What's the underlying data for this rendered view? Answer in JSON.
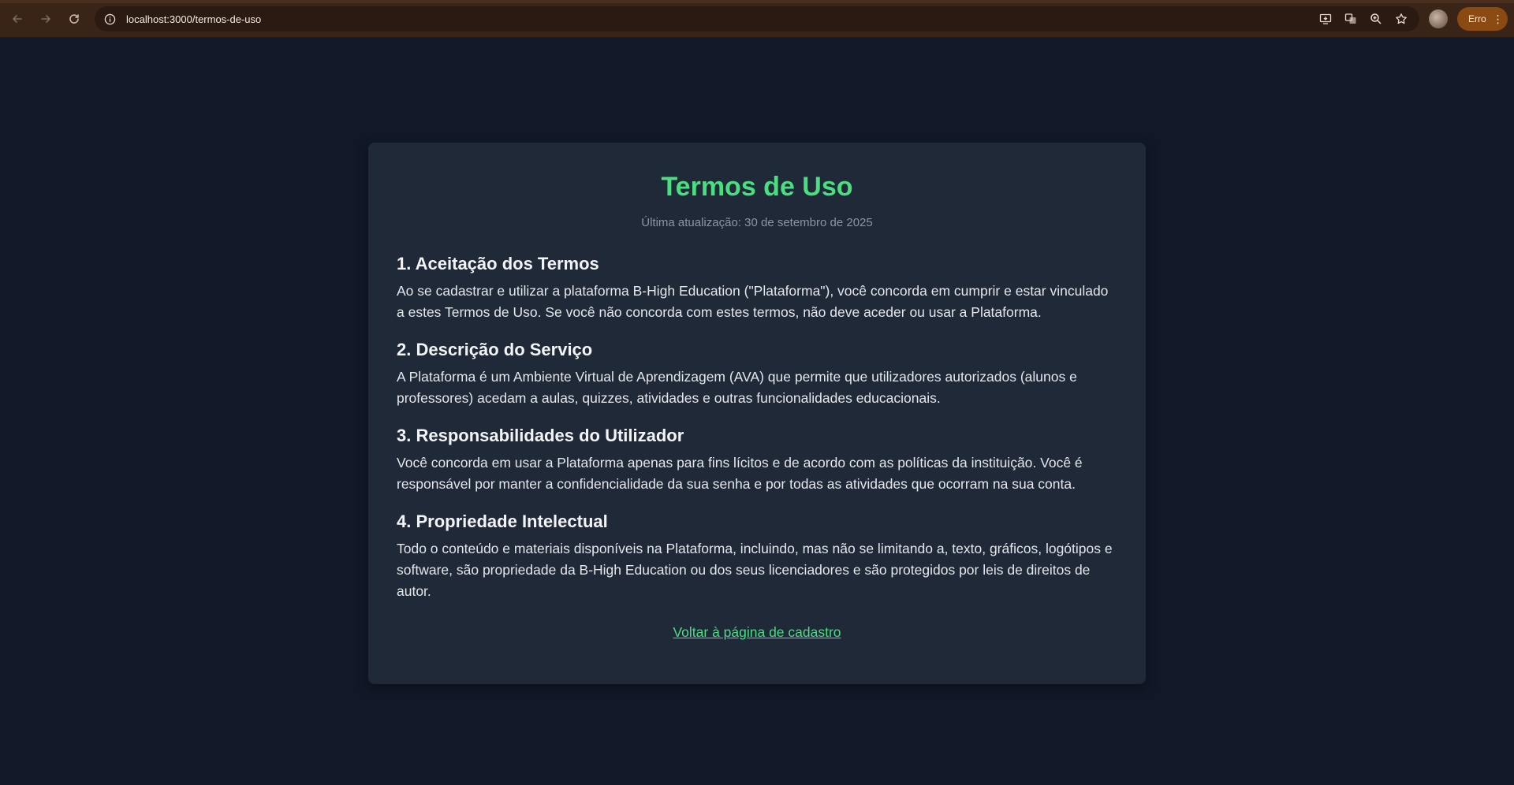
{
  "browser": {
    "url": "localhost:3000/termos-de-uso",
    "profile_chip_label": "Erro"
  },
  "page": {
    "title": "Termos de Uso",
    "last_updated": "Última atualização: 30 de setembro de 2025",
    "sections": [
      {
        "heading": "1. Aceitação dos Termos",
        "body": "Ao se cadastrar e utilizar a plataforma B-High Education (\"Plataforma\"), você concorda em cumprir e estar vinculado a estes Termos de Uso. Se você não concorda com estes termos, não deve aceder ou usar a Plataforma."
      },
      {
        "heading": "2. Descrição do Serviço",
        "body": "A Plataforma é um Ambiente Virtual de Aprendizagem (AVA) que permite que utilizadores autorizados (alunos e professores) acedam a aulas, quizzes, atividades e outras funcionalidades educacionais."
      },
      {
        "heading": "3. Responsabilidades do Utilizador",
        "body": "Você concorda em usar a Plataforma apenas para fins lícitos e de acordo com as políticas da instituição. Você é responsável por manter a confidencialidade da sua senha e por todas as atividades que ocorram na sua conta."
      },
      {
        "heading": "4. Propriedade Intelectual",
        "body": "Todo o conteúdo e materiais disponíveis na Plataforma, incluindo, mas não se limitando a, texto, gráficos, logótipos e software, são propriedade da B-High Education ou dos seus licenciadores e são protegidos por leis de direitos de autor."
      }
    ],
    "back_link": "Voltar à página de cadastro"
  },
  "colors": {
    "page_background": "#111827",
    "card_background": "#1f2937",
    "accent_green": "#4ade80",
    "browser_toolbar": "#3a2418",
    "error_chip": "#8a4a12"
  }
}
